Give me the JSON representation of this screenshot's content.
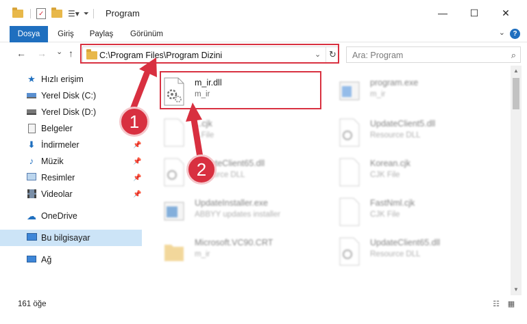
{
  "window": {
    "title": "Program",
    "minimize": "—",
    "maximize": "☐",
    "close": "✕"
  },
  "ribbon": {
    "tabs": [
      "Dosya",
      "Giriş",
      "Paylaş",
      "Görünüm"
    ],
    "help": "?"
  },
  "nav": {
    "back": "←",
    "forward": "→",
    "recent": "⌄",
    "up": "↑",
    "address": "C:\\Program Files\\Program Dizini",
    "search_placeholder": "Ara: Program"
  },
  "sidebar": {
    "items": [
      {
        "label": "Hızlı erişim",
        "icon": "star-icon",
        "pinned": false
      },
      {
        "label": "Yerel Disk (C:)",
        "icon": "drive-icon",
        "pinned": false
      },
      {
        "label": "Yerel Disk (D:)",
        "icon": "drive-icon",
        "pinned": false
      },
      {
        "label": "Belgeler",
        "icon": "document-icon",
        "pinned": true
      },
      {
        "label": "İndirmeler",
        "icon": "download-icon",
        "pinned": true
      },
      {
        "label": "Müzik",
        "icon": "music-icon",
        "pinned": true
      },
      {
        "label": "Resimler",
        "icon": "pictures-icon",
        "pinned": true
      },
      {
        "label": "Videolar",
        "icon": "video-icon",
        "pinned": true
      },
      {
        "label": "OneDrive",
        "icon": "cloud-icon",
        "pinned": false
      },
      {
        "label": "Bu bilgisayar",
        "icon": "computer-icon",
        "pinned": false
      },
      {
        "label": "Ağ",
        "icon": "network-icon",
        "pinned": false
      }
    ]
  },
  "files": [
    {
      "name": "m_ir.dll",
      "type": "m_ir"
    },
    {
      "name": "program.exe",
      "type": "m_ir"
    },
    {
      "name": "...cjk",
      "type": "...File"
    },
    {
      "name": "UpdateClient5.dll",
      "type": "Resource DLL"
    },
    {
      "name": "UpdateClient65.dll",
      "type": "Resource DLL"
    },
    {
      "name": "Korean.cjk",
      "type": "CJK File"
    },
    {
      "name": "UpdateInstaller.exe",
      "type": "ABBYY updates installer"
    },
    {
      "name": "FastNml.cjk",
      "type": "CJK File"
    },
    {
      "name": "Microsoft.VC90.CRT",
      "type": "m_ir"
    },
    {
      "name": "UpdateClient65.dll",
      "type": "Resource DLL"
    }
  ],
  "status": {
    "count": "161 öğe"
  },
  "annotations": {
    "badge1": "1",
    "badge2": "2"
  },
  "colors": {
    "accent": "#1f6fbf",
    "highlight": "#d83040",
    "selected": "#cce4f7"
  }
}
